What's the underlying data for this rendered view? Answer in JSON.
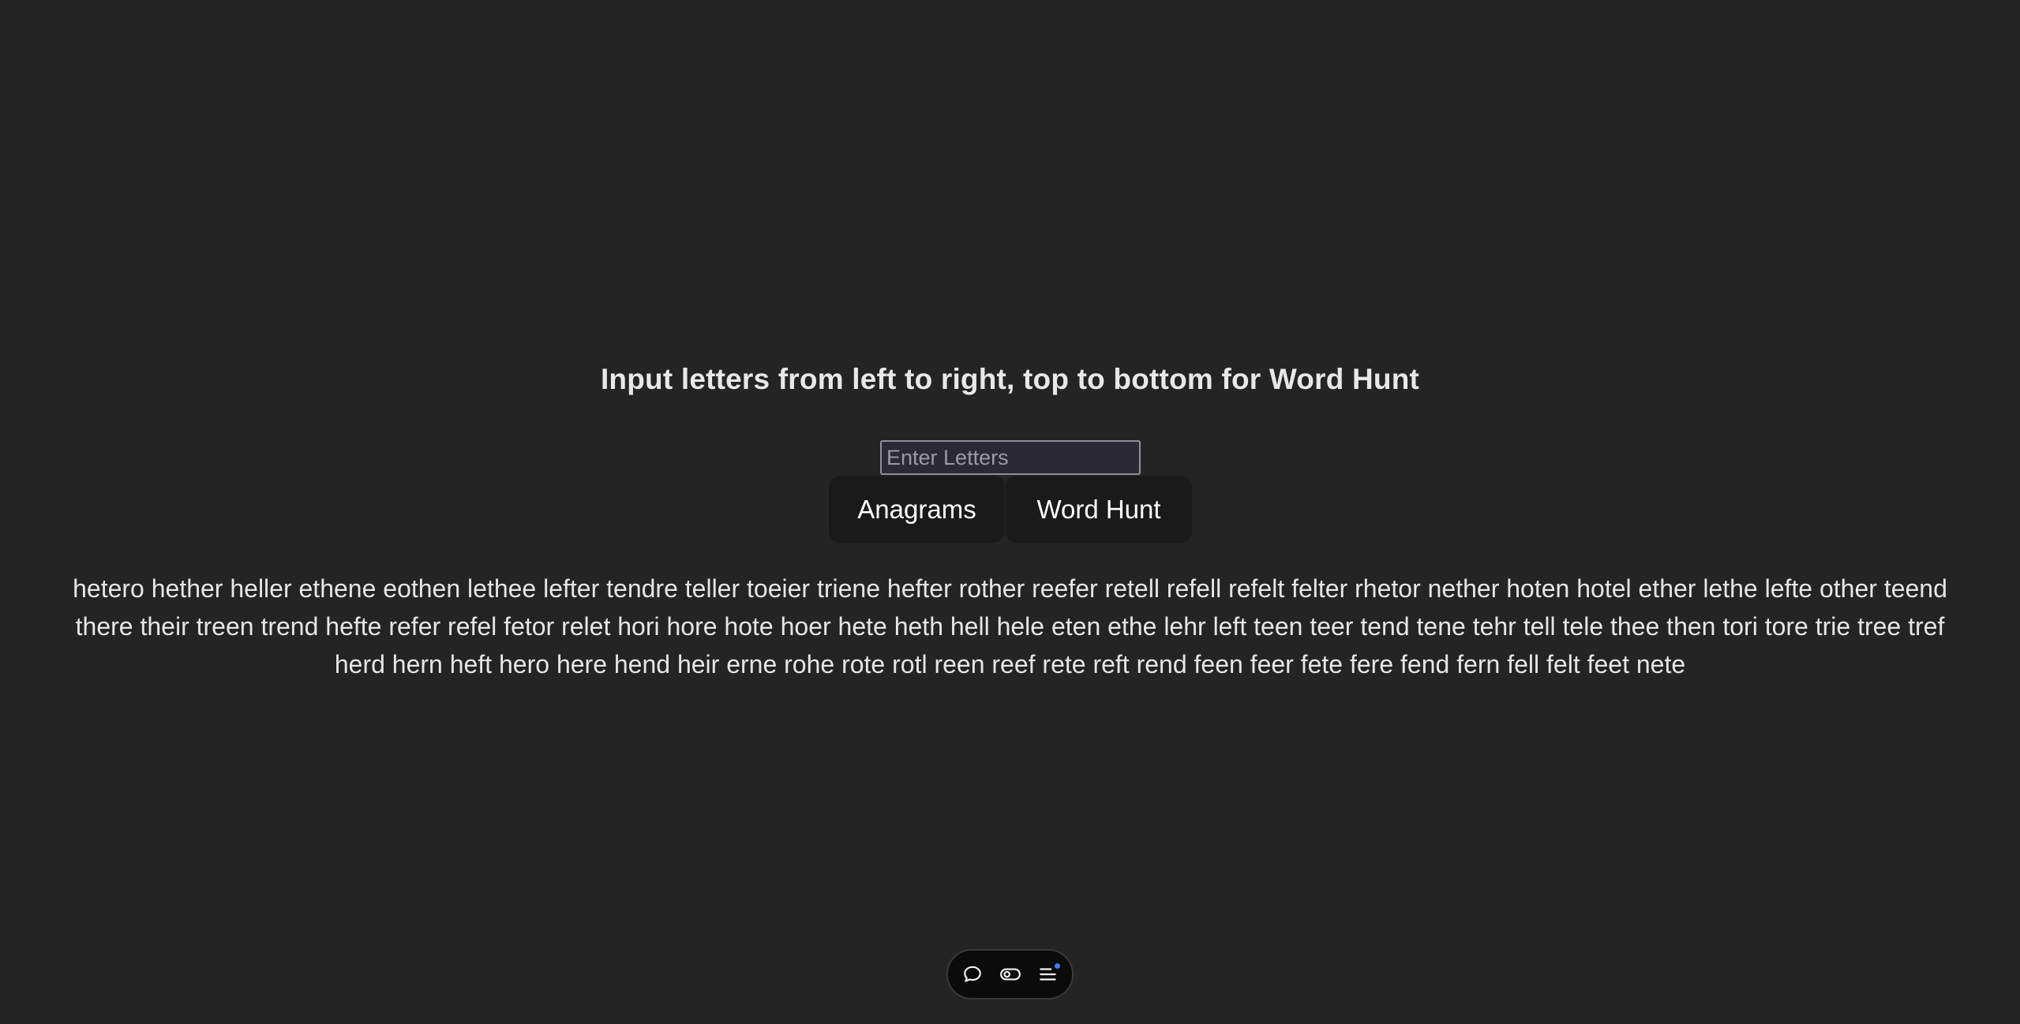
{
  "heading": "Input letters from left to right, top to bottom for Word Hunt",
  "input": {
    "placeholder": "Enter Letters",
    "value": ""
  },
  "buttons": {
    "anagrams": "Anagrams",
    "word_hunt": "Word Hunt"
  },
  "results": {
    "line1": "hetero hether heller ethene eothen lethee lefter tendre teller toeier triene hefter rother reefer retell refell refelt felter rhetor nether hoten hotel ether lethe lefte other teend",
    "line2": "there their treen trend hefte refer refel fetor relet hori hore hote hoer hete heth hell hele eten ethe lehr left teen teer tend tene tehr tell tele thee then tori tore trie tree tref",
    "line3": "herd hern heft hero here hend heir erne rohe rote rotl reen reef rete reft rend feen feer fete fere fend fern fell felt feet nete"
  },
  "toolbar": {
    "icons": [
      "chat-bubble-icon",
      "toggle-eye-icon",
      "menu-list-icon"
    ],
    "notification_color": "#3b82f6"
  }
}
